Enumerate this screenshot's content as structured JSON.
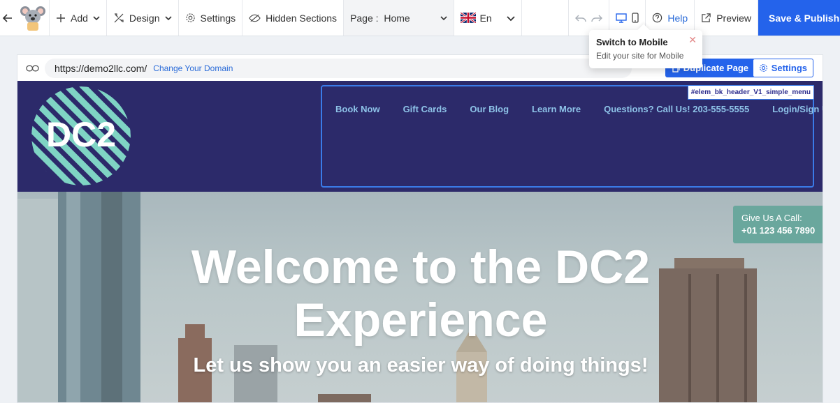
{
  "toolbar": {
    "add_label": "Add",
    "design_label": "Design",
    "settings_label": "Settings",
    "hidden_sections_label": "Hidden Sections",
    "page_prefix": "Page :",
    "page_value": "Home",
    "language": "En",
    "help_label": "Help",
    "preview_label": "Preview",
    "publish_label": "Save & Publish"
  },
  "tooltip": {
    "title": "Switch to Mobile",
    "subtitle": "Edit your site for Mobile",
    "close": "✕"
  },
  "editor": {
    "url": "https://demo2llc.com/",
    "change_domain": "Change Your Domain",
    "duplicate_label": "Duplicate Page",
    "settings_label": "Settings"
  },
  "site": {
    "brand_text": "DC2",
    "element_tag": "#elem_bk_header_V1_simple_menu",
    "menu": [
      "Book Now",
      "Gift Cards",
      "Our Blog",
      "Learn More",
      "Questions? Call Us! 203-555-5555",
      "Login/Sign Up"
    ],
    "hero_title_1": "Welcome to the DC2",
    "hero_title_2": "Experience",
    "hero_subtitle": "Let us show you an easier way of doing things!",
    "call_label": "Give Us A Call:",
    "call_number": "+01 123 456 7890"
  },
  "colors": {
    "accent": "#2463eb",
    "header_bg": "#2c2a6a",
    "menu_text": "#8ec3e8",
    "logo_stripe": "#7fd4c4",
    "call_bg": "#6aa79d"
  }
}
